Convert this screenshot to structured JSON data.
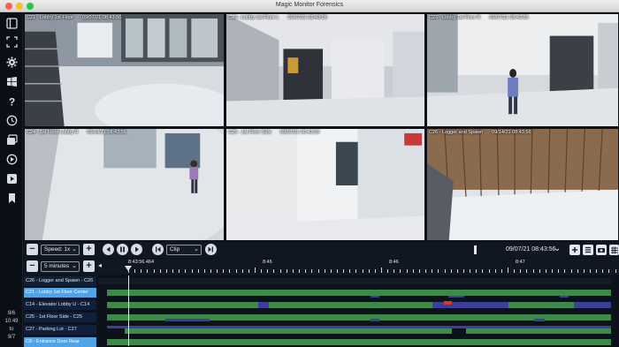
{
  "window": {
    "title": "Magic Monitor Forensics"
  },
  "sidebar": {
    "icons": [
      "panel-icon",
      "fullscreen-icon",
      "settings-icon",
      "windows-icon",
      "help-icon",
      "clock-icon",
      "clip-icon",
      "play-circle-icon",
      "export-icon",
      "bookmark-icon"
    ],
    "date_lines": [
      "9/6",
      "10:49",
      "to",
      "9/7"
    ]
  },
  "cameras": [
    {
      "name": "C21 - Lobby 1st Floor",
      "timestamp": "09/07/21 08:43:56"
    },
    {
      "name": "C23 - Lobby 1st Floor L",
      "timestamp": "09/07/21 08:43:56"
    },
    {
      "name": "C23 - Lobby 1st Floor R",
      "timestamp": "09/07/21 08:43:56"
    },
    {
      "name": "C24 - 1st Floor Lobby R",
      "timestamp": "09/14/21 08:43:56"
    },
    {
      "name": "C25 - 1st Floor Side",
      "timestamp": "09/07/21 08:43:56"
    },
    {
      "name": "C26 - Logger and Spawn",
      "timestamp": "09/14/21 08:43:56"
    }
  ],
  "controls": {
    "speed_label": "Speed: 1x",
    "clip_label": "Clip",
    "current_datetime": "09/07/21 08:43:56",
    "interval_label": "5 minutes",
    "playhead_time": "8:43:56.464",
    "ticks": [
      "8:45",
      "8:46",
      "8:47"
    ]
  },
  "tracks": [
    {
      "label": "C26 - Logger and Spawn - C26"
    },
    {
      "label": "C21 - Lobby 1st Floor Center"
    },
    {
      "label": "C14 - Elevator Lobby U - C14"
    },
    {
      "label": "C25 - 1st Floor Side - C25"
    },
    {
      "label": "C27 - Parking Lot - C27"
    },
    {
      "label": "C8 - Entrance Door Rear"
    }
  ],
  "colors": {
    "accent": "#4fa3e6",
    "motion": "#3e8a4a",
    "event": "#3a3f99",
    "alert": "#d23a3a"
  }
}
